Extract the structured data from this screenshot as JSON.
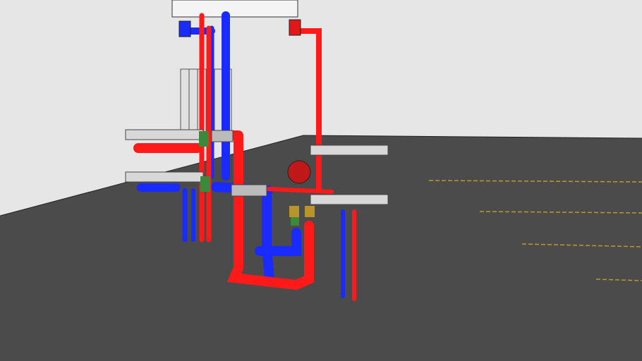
{
  "scene": {
    "colors": {
      "wall": "#e6e6e6",
      "floor": "#4b4b4b",
      "hot_pipe": "#ff1a1a",
      "cold_pipe": "#1a2bff",
      "metal": "#d8d8d8",
      "fitting_green": "#3a8a3a",
      "pump": "#c01818",
      "floor_marks": "#b89a2a"
    }
  }
}
